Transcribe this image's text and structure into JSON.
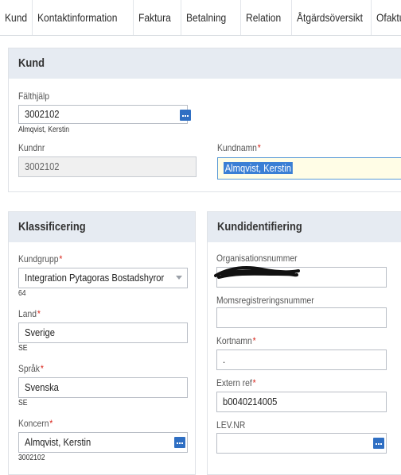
{
  "tabs": [
    "Kund",
    "Kontaktinformation",
    "Faktura",
    "Betalning",
    "Relation",
    "Åtgärdsöversikt",
    "Ofakturera"
  ],
  "kund_panel": {
    "title": "Kund",
    "falthjalp_label": "Fälthjälp",
    "falthjalp_value": "3002102",
    "falthjalp_sub": "Almqvist, Kerstin",
    "kundnr_label": "Kundnr",
    "kundnr_value": "3002102",
    "kundnamn_label": "Kundnamn",
    "kundnamn_value": "Almqvist, Kerstin"
  },
  "klass_panel": {
    "title": "Klassificering",
    "kundgrupp_label": "Kundgrupp",
    "kundgrupp_value": "Integration Pytagoras Bostadshyror",
    "kundgrupp_sub": "64",
    "land_label": "Land",
    "land_value": "Sverige",
    "land_sub": "SE",
    "sprak_label": "Språk",
    "sprak_value": "Svenska",
    "sprak_sub": "SE",
    "koncern_label": "Koncern",
    "koncern_value": "Almqvist, Kerstin",
    "koncern_sub": "3002102"
  },
  "ident_panel": {
    "title": "Kundidentifiering",
    "orgnr_label": "Organisationsnummer",
    "orgnr_value": "",
    "moms_label": "Momsregistreringsnummer",
    "moms_value": "",
    "kortnamn_label": "Kortnamn",
    "kortnamn_value": ".",
    "extern_label": "Extern ref",
    "extern_value": "b0040214005",
    "levnr_label": "LEV.NR",
    "levnr_value": ""
  },
  "required_mark": "*"
}
